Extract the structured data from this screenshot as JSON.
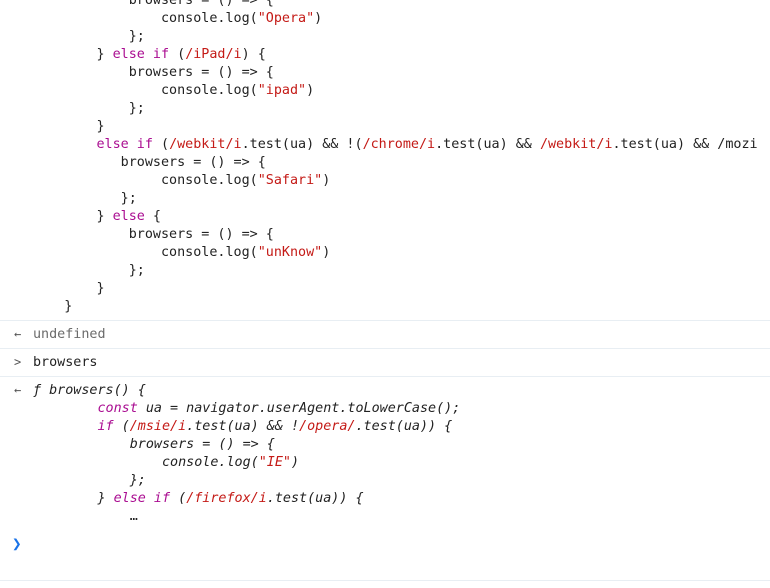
{
  "code_block_1": {
    "lines": [
      "            browsers = () => {",
      "                console.log(\"Opera\")",
      "            };",
      "        } else if (/iPad/i) {",
      "            browsers = () => {",
      "                console.log(\"ipad\")",
      "            };",
      "        }",
      "        else if (/webkit/i.test(ua) && !(/chrome/i.test(ua) && /webkit/i.test(ua) && /mozi",
      "           browsers = () => {",
      "                console.log(\"Safari\")",
      "           };",
      "        } else {",
      "            browsers = () => {",
      "                console.log(\"unKnow\")",
      "            };",
      "        }",
      "    }"
    ]
  },
  "output_1": {
    "marker": "←",
    "text": "undefined"
  },
  "input_1": {
    "marker": ">",
    "text": "browsers"
  },
  "output_2": {
    "marker": "←",
    "func_sig": "ƒ browsers() {",
    "lines": [
      "        const ua = navigator.userAgent.toLowerCase();",
      "        if (/msie/i.test(ua) && !/opera/.test(ua)) {",
      "            browsers = () => {",
      "                console.log(\"IE\")",
      "            };",
      "        } else if (/firefox/i.test(ua)) {",
      "            …"
    ]
  },
  "prompt": {
    "caret": "❯"
  },
  "colors": {
    "keyword": "#aa0d91",
    "string": "#c41a16",
    "prompt": "#1a73e8",
    "separator": "#e8eef3"
  }
}
